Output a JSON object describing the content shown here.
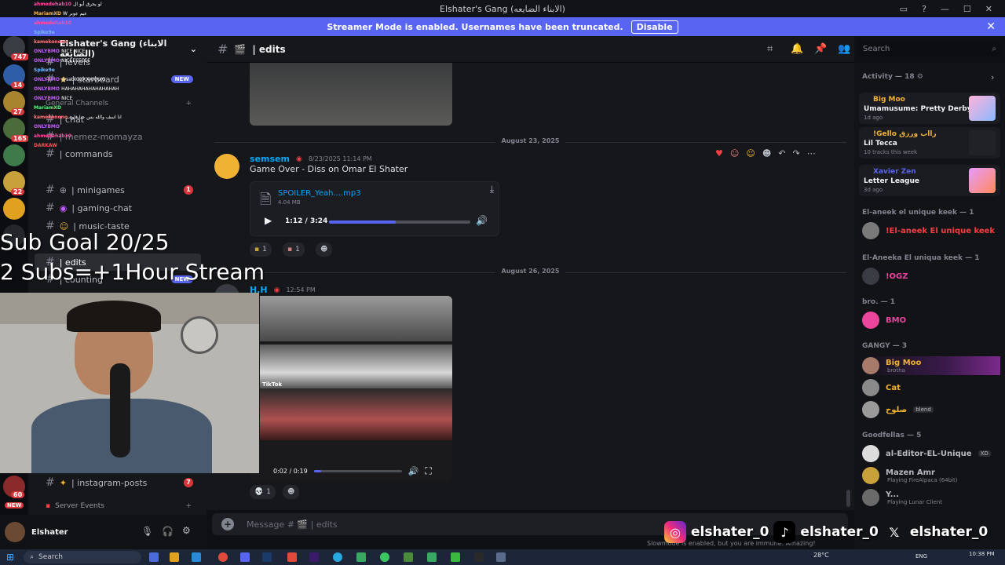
{
  "window": {
    "title": "Elshater's Gang (الابناء الضايعه)"
  },
  "banner": {
    "text": "Streamer Mode is enabled. Usernames have been truncated.",
    "button": "Disable"
  },
  "rail": {
    "badges": [
      "747",
      "14",
      "27",
      "165",
      "22",
      "60"
    ],
    "new_label": "NEW"
  },
  "server": {
    "name": "Elshater's Gang (الابناء الضايعه)"
  },
  "channels": [
    {
      "name": "| levels"
    },
    {
      "name": "| starboard",
      "badge": "NEW"
    },
    {
      "name": "General Channels"
    },
    {
      "name": "| chat"
    },
    {
      "name": "| memez-momayza"
    },
    {
      "name": "| commands"
    },
    {
      "name": "| minigames",
      "count": "1"
    },
    {
      "name": "| gaming-chat"
    },
    {
      "name": "| music-taste"
    },
    {
      "name": "| edits"
    },
    {
      "name": "| counting",
      "badge": "NEW"
    },
    {
      "name": "| instagram-posts",
      "count": "7"
    }
  ],
  "server_events": "Server Events",
  "user": {
    "name": "Elshater"
  },
  "header": {
    "channel": "| edits",
    "search_placeholder": "Search"
  },
  "messages": {
    "date1": "August 23, 2025",
    "msg1": {
      "author": "semsem",
      "time": "8/23/2025 11:14 PM",
      "text": "Game Over - Diss on Omar El Shater",
      "file": "SPOILER_Yeah....mp3",
      "size": "4.04 MB",
      "time_display": "1:12 / 3:24",
      "progress": 0.47,
      "reactions": [
        "1",
        "1"
      ]
    },
    "date2": "August 26, 2025",
    "msg2": {
      "author": "H.H",
      "time": "12:54 PM",
      "video_time": "0:02 / 0:19",
      "progress": 0.08,
      "watermark": "TikTok",
      "reactions": [
        "1"
      ]
    }
  },
  "composer": {
    "placeholder": "Message # 🎬 | edits"
  },
  "slowmode": "Slowmode is enabled, but you are immune. Amazing!",
  "members": {
    "activity_header": "Activity — 18",
    "activities": [
      {
        "name": "Big Moo",
        "title": "Umamusume: Pretty Derby",
        "meta": "1d ago",
        "name_color": "#f0b232"
      },
      {
        "name": "!Gello رااب ورزق",
        "title": "Lil Tecca",
        "meta": "10 tracks this week",
        "name_color": "#f0b232"
      },
      {
        "name": "Xavier Zen",
        "title": "Letter League",
        "meta": "3d ago",
        "name_color": "#5865f2"
      }
    ],
    "groups": [
      {
        "label": "El-aneek el unique keek — 1",
        "members": [
          {
            "name": "!El-aneek El unique keek",
            "color": "#f23f43"
          }
        ]
      },
      {
        "label": "El-Aneeka El uniqua keek — 1",
        "members": [
          {
            "name": "!OGZ",
            "color": "#eb459e"
          }
        ]
      },
      {
        "label": "bro. — 1",
        "members": [
          {
            "name": "BMO",
            "color": "#eb459e"
          }
        ]
      },
      {
        "label": "GANGY — 3",
        "members": [
          {
            "name": "Big Moo",
            "color": "#f0b232",
            "sub": "brotha"
          },
          {
            "name": "Cat",
            "color": "#f0b232"
          },
          {
            "name": "صلوح",
            "color": "#f0b232",
            "tag": "blend"
          }
        ]
      },
      {
        "label": "Goodfellas — 5",
        "members": [
          {
            "name": "al-Editor-EL-Unique",
            "color": "#b5bac1",
            "tag": "XD"
          },
          {
            "name": "Mazen Amr",
            "color": "#b5bac1",
            "sub": "Playing FireAlpaca (64bit)"
          },
          {
            "name": "Y...",
            "color": "#b5bac1",
            "sub": "Playing Lunar Client"
          }
        ]
      }
    ]
  },
  "overlay": {
    "goal_line1": "Sub Goal 20/25",
    "goal_line2": "2 Subs=+1Hour Stream",
    "social_handle": "elshater_0",
    "chat": [
      {
        "user": "ahmedehab10",
        "text": "لو يحرق أبو ال",
        "color": "#ff4fa3"
      },
      {
        "user": "MariamXD",
        "text": "W عيم عوبر",
        "color": "#ffb347"
      },
      {
        "user": "ahmedehab10",
        "text": "",
        "color": "#ff4fa3"
      },
      {
        "user": "Spike9e",
        "text": "",
        "color": "#7ab8ff"
      },
      {
        "user": "kamekonono",
        "text": "",
        "color": "#ff7a7a"
      },
      {
        "user": "ONLYBMO",
        "text": "NICE NICE",
        "color": "#c45cff"
      },
      {
        "user": "ONLYBMO",
        "text": "NICEEEEEEE",
        "color": "#c45cff"
      },
      {
        "user": "Spike9e",
        "text": "",
        "color": "#7ab8ff"
      },
      {
        "user": "ONLYBMO",
        "text": "@satXOXXXXXXXO",
        "color": "#c45cff"
      },
      {
        "user": "ONLYBMO",
        "text": "HAHAHAHAHAHAHAHAH",
        "color": "#c45cff"
      },
      {
        "user": "ONLYBMO",
        "text": "NICE",
        "color": "#c45cff"
      },
      {
        "user": "MariamXD",
        "text": "",
        "color": "#4fff7a"
      },
      {
        "user": "kamekonono",
        "text": "انا اسف والله بس حنا فاوه",
        "color": "#ff7a7a"
      },
      {
        "user": "ONLYBMO",
        "text": "",
        "color": "#c45cff"
      },
      {
        "user": "ahmedehab10",
        "text": "",
        "color": "#ff4fa3"
      },
      {
        "user": "DARKAW",
        "text": "",
        "color": "#ff4f4f"
      }
    ]
  },
  "taskbar": {
    "search": "Search",
    "weather": "28°C",
    "lang": "ENG",
    "time": "10:38 PM"
  },
  "colors": {
    "accent": "#5865f2",
    "bg": "#16171b",
    "mention_red": "#da373c"
  }
}
